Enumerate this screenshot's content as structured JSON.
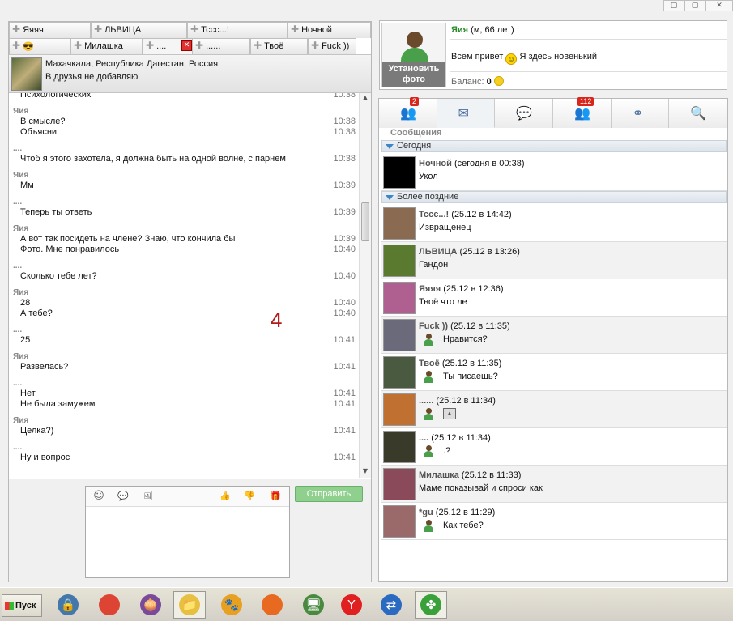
{
  "window": {
    "buttons": [
      "▢",
      "▢",
      "✕"
    ]
  },
  "chat_tabs": {
    "row1": [
      "Яяяя",
      "ЛЬВИЦА",
      "Тссс...!",
      "Ночной"
    ],
    "row2": [
      "😎",
      "Милашка",
      "....",
      "......",
      "Твоё",
      "Fuck ))"
    ]
  },
  "contact": {
    "location": "Махачкала, Республика Дагестан, Россия",
    "friend_status": "В друзья не добавляю"
  },
  "chat_messages": [
    {
      "author": "",
      "lines": [
        {
          "text": "Психологических",
          "time": "10:38"
        }
      ]
    },
    {
      "author": "Яия",
      "lines": [
        {
          "text": "В смысле?",
          "time": "10:38"
        },
        {
          "text": "Объясни",
          "time": "10:38"
        }
      ]
    },
    {
      "author": "....",
      "lines": [
        {
          "text": "Чтоб я этого захотела, я должна быть на одной волне, с парнем",
          "time": "10:38"
        }
      ]
    },
    {
      "author": "Яия",
      "lines": [
        {
          "text": "Мм",
          "time": "10:39"
        }
      ]
    },
    {
      "author": "....",
      "lines": [
        {
          "text": "Теперь ты ответь",
          "time": "10:39"
        }
      ]
    },
    {
      "author": "Яия",
      "lines": [
        {
          "text": "А вот так посидеть на члене? Знаю, что кончила бы",
          "time": "10:39"
        },
        {
          "text": "Фото. Мне понравилось",
          "time": "10:40"
        }
      ]
    },
    {
      "author": "....",
      "lines": [
        {
          "text": "Сколько тебе лет?",
          "time": "10:40"
        }
      ]
    },
    {
      "author": "Яия",
      "lines": [
        {
          "text": "28",
          "time": "10:40"
        },
        {
          "text": "А тебе?",
          "time": "10:40"
        }
      ]
    },
    {
      "author": "....",
      "lines": [
        {
          "text": "25",
          "time": "10:41"
        }
      ]
    },
    {
      "author": "Яия",
      "lines": [
        {
          "text": "Развелась?",
          "time": "10:41"
        }
      ]
    },
    {
      "author": "....",
      "lines": [
        {
          "text": "Нет",
          "time": "10:41"
        },
        {
          "text": "Не была замужем",
          "time": "10:41"
        }
      ]
    },
    {
      "author": "Яия",
      "lines": [
        {
          "text": "Целка?)",
          "time": "10:41"
        }
      ]
    },
    {
      "author": "....",
      "lines": [
        {
          "text": "Ну и вопрос",
          "time": "10:41"
        }
      ]
    }
  ],
  "annotation_number": "4",
  "compose": {
    "send_label": "Отправить",
    "tools": [
      "☺",
      "💬",
      "🖼",
      "👍",
      "👎",
      "🎁"
    ]
  },
  "profile": {
    "set_photo_label": "Установить фото",
    "name": "Яия",
    "meta": "(м, 66 лет)",
    "greeting_before": "Всем привет",
    "greeting_after": "Я здесь новенький",
    "balance_label": "Баланс:",
    "balance_value": "0"
  },
  "right_tabs": [
    {
      "name": "friends",
      "icon": "👥",
      "badge": "2"
    },
    {
      "name": "messages",
      "icon": "✉",
      "badge": ""
    },
    {
      "name": "chats",
      "icon": "💬",
      "badge": ""
    },
    {
      "name": "groups",
      "icon": "👥",
      "badge": "112"
    },
    {
      "name": "bluetooth",
      "icon": "⚭",
      "badge": ""
    },
    {
      "name": "search",
      "icon": "🔍",
      "badge": ""
    }
  ],
  "messages_section": "Сообщения",
  "group_today": "Сегодня",
  "group_older": "Более поздние",
  "conversations_today": [
    {
      "name": "Ночной",
      "when": "(сегодня в 00:38)",
      "text": "Укол",
      "thumb_color": "#000000",
      "kind": "text"
    }
  ],
  "conversations_older": [
    {
      "name": "Тссс...!",
      "when": "(25.12 в 14:42)",
      "text": "Извращенец",
      "thumb_color": "#8a6a50",
      "kind": "text"
    },
    {
      "name": "ЛЬВИЦА",
      "when": "(25.12 в 13:26)",
      "text": "Гандон",
      "thumb_color": "#5a7a30",
      "kind": "text"
    },
    {
      "name": "Яяяя",
      "when": "(25.12 в 12:36)",
      "text": "Твоё что ле",
      "thumb_color": "#b06090",
      "kind": "text"
    },
    {
      "name": "Fuck ))",
      "when": "(25.12 в 11:35)",
      "text": "Нравится?",
      "thumb_color": "#6a6a7a",
      "kind": "reply"
    },
    {
      "name": "Твоё",
      "when": "(25.12 в 11:35)",
      "text": "Ты писаешь?",
      "thumb_color": "#4a5a40",
      "kind": "reply"
    },
    {
      "name": "......",
      "when": "(25.12 в 11:34)",
      "text": "",
      "thumb_color": "#c07030",
      "kind": "image"
    },
    {
      "name": "....",
      "when": "(25.12 в 11:34)",
      "text": ".?",
      "thumb_color": "#3a3a2a",
      "kind": "reply"
    },
    {
      "name": "Милашка",
      "when": "(25.12 в 11:33)",
      "text": "Маме показывай и спроси как",
      "thumb_color": "#8a4a5a",
      "kind": "text"
    },
    {
      "name": "*gu",
      "when": "(25.12 в 11:29)",
      "text": "Как тебе?",
      "thumb_color": "#9a6a6a",
      "kind": "reply"
    }
  ],
  "taskbar": {
    "start_label": "Пуск",
    "apps": [
      {
        "name": "network-app",
        "glyph": "🔒",
        "color": "#4477aa"
      },
      {
        "name": "chrome",
        "glyph": "",
        "color": "#dd4433"
      },
      {
        "name": "tor",
        "glyph": "🧅",
        "color": "#7a4a9a"
      },
      {
        "name": "explorer",
        "glyph": "📁",
        "color": "#e8c040"
      },
      {
        "name": "paw-app",
        "glyph": "🐾",
        "color": "#e8a020"
      },
      {
        "name": "firefox",
        "glyph": "",
        "color": "#e86a20"
      },
      {
        "name": "remote-app",
        "glyph": "🖥",
        "color": "#4a8a40"
      },
      {
        "name": "yandex",
        "glyph": "Y",
        "color": "#e02020"
      },
      {
        "name": "teamviewer",
        "glyph": "⇄",
        "color": "#2a6ac0"
      },
      {
        "name": "clover-app",
        "glyph": "✤",
        "color": "#3aa03a"
      }
    ]
  }
}
